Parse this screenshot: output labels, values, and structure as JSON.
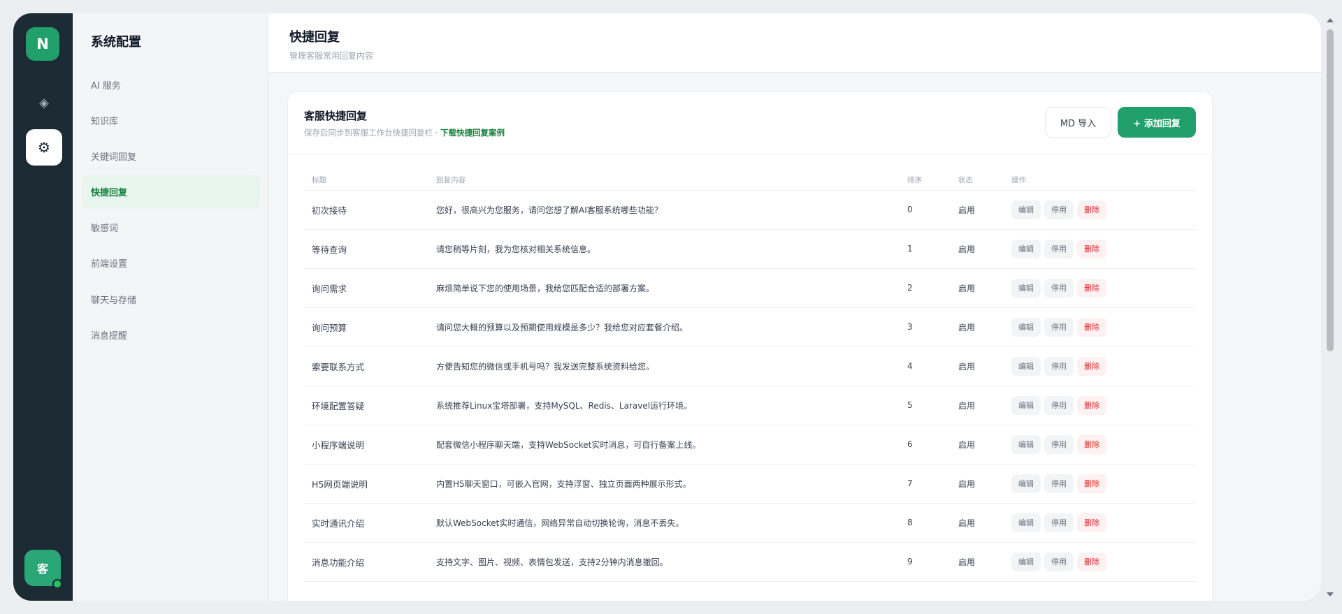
{
  "rail": {
    "logo_letter": "N",
    "diamond_icon": "◈",
    "settings_icon": "⚙",
    "avatar_letter": "客"
  },
  "sidebar": {
    "title": "系统配置",
    "items": [
      {
        "label": "AI 服务"
      },
      {
        "label": "知识库"
      },
      {
        "label": "关键词回复"
      },
      {
        "label": "快捷回复",
        "active": true
      },
      {
        "label": "敏感词"
      },
      {
        "label": "前端设置"
      },
      {
        "label": "聊天与存储"
      },
      {
        "label": "消息提醒"
      }
    ]
  },
  "header": {
    "title": "快捷回复",
    "subtitle": "管理客服常用回复内容"
  },
  "card": {
    "title": "客服快捷回复",
    "desc": "保存后同步到客服工作台快捷回复栏 · ",
    "link": "下载快捷回复案例",
    "import_label": "MD 导入",
    "add_label": "+ 添加回复"
  },
  "table": {
    "columns": {
      "title": "标题",
      "content": "回复内容",
      "order": "排序",
      "status": "状态",
      "actions": "操作"
    },
    "action_labels": {
      "edit": "编辑",
      "disable": "停用",
      "delete": "删除"
    },
    "rows": [
      {
        "title": "初次接待",
        "content": "您好，很高兴为您服务，请问您想了解AI客服系统哪些功能？",
        "order": "0",
        "status": "启用"
      },
      {
        "title": "等待查询",
        "content": "请您稍等片刻，我为您核对相关系统信息。",
        "order": "1",
        "status": "启用"
      },
      {
        "title": "询问需求",
        "content": "麻烦简单说下您的使用场景，我给您匹配合适的部署方案。",
        "order": "2",
        "status": "启用"
      },
      {
        "title": "询问预算",
        "content": "请问您大概的预算以及预期使用规模是多少？我给您对应套餐介绍。",
        "order": "3",
        "status": "启用"
      },
      {
        "title": "索要联系方式",
        "content": "方便告知您的微信或手机号吗？我发送完整系统资料给您。",
        "order": "4",
        "status": "启用"
      },
      {
        "title": "环境配置答疑",
        "content": "系统推荐Linux宝塔部署，支持MySQL、Redis、Laravel运行环境。",
        "order": "5",
        "status": "启用"
      },
      {
        "title": "小程序端说明",
        "content": "配套微信小程序聊天端，支持WebSocket实时消息，可自行备案上线。",
        "order": "6",
        "status": "启用"
      },
      {
        "title": "H5网页端说明",
        "content": "内置H5聊天窗口，可嵌入官网，支持浮窗、独立页面两种展示形式。",
        "order": "7",
        "status": "启用"
      },
      {
        "title": "实时通讯介绍",
        "content": "默认WebSocket实时通信，网络异常自动切换轮询，消息不丢失。",
        "order": "8",
        "status": "启用"
      },
      {
        "title": "消息功能介绍",
        "content": "支持文字、图片、视频、表情包发送，支持2分钟内消息撤回。",
        "order": "9",
        "status": "启用"
      }
    ]
  }
}
